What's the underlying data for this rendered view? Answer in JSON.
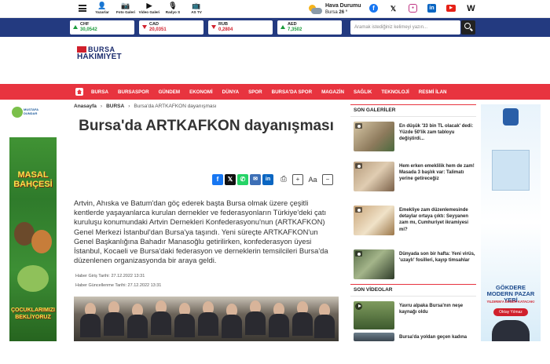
{
  "header": {
    "top_links": [
      {
        "label": "Yazarlar",
        "icon": "writers-icon"
      },
      {
        "label": "Foto Galeri",
        "icon": "photo-gallery-icon"
      },
      {
        "label": "Video Galeri",
        "icon": "video-gallery-icon"
      },
      {
        "label": "Radyo S",
        "icon": "radio-icon"
      },
      {
        "label": "AS TV",
        "icon": "tv-icon"
      }
    ],
    "weather": {
      "title": "Hava Durumu",
      "city": "Bursa",
      "temp": "26 °"
    },
    "socials": [
      "facebook",
      "x",
      "instagram",
      "linkedin",
      "youtube",
      "w"
    ]
  },
  "markets": [
    {
      "code": "CHF",
      "value": "30,0542",
      "trend": "up"
    },
    {
      "code": "CAD",
      "value": "20,0351",
      "trend": "down"
    },
    {
      "code": "RUB",
      "value": "0,2804",
      "trend": "down"
    },
    {
      "code": "AED",
      "value": "7,3502",
      "trend": "up"
    }
  ],
  "search": {
    "placeholder": "Aramak istediğiniz kelimeyi yazın..."
  },
  "logo": {
    "line1": "BURSA",
    "line2": "HAKIMIYET"
  },
  "nav": [
    "BURSA",
    "BURSASPOR",
    "GÜNDEM",
    "EKONOMİ",
    "DÜNYA",
    "SPOR",
    "BURSA'DA SPOR",
    "MAGAZİN",
    "SAĞLIK",
    "TEKNOLOJİ",
    "RESMİ İLAN"
  ],
  "left_ad": {
    "brand_line1": "MUSTAFA",
    "brand_line2": "DUNDAR",
    "title": "MASAL BAHÇESİ",
    "bottom": "ÇOCUKLARIMIZI BEKLİYORUZ"
  },
  "right_ad": {
    "title": "GÖKDERE MODERN PAZAR YERİ",
    "subtitle": "YILDIRIM'A DEĞER KATACAK!",
    "signature": "Oktay Yılmaz",
    "name": "OKTAY YILMAZ"
  },
  "article": {
    "breadcrumb": [
      "Anasayfa",
      "BURSA",
      "Bursa'da ARTKAFKON dayanışması"
    ],
    "title": "Bursa'da ARTKAFKON dayanışması",
    "summary": "Artvin, Ahıska ve Batum'dan göç ederek başta Bursa olmak üzere çeşitli kentlerde yaşayanlarca kurulan dernekler ve federasyonların Türkiye'deki çatı kuruluşu konumundaki Artvin Dernekleri Konfederasyonu'nun (ARTKAFKON) Genel Merkezi İstanbul'dan Bursa'ya taşındı. Yeni süreçte ARTKAFKON'un Genel Başkanlığına Bahadır Manasoğlu getirilirken, konfederasyon üyesi İstanbul, Kocaeli ve Bursa'daki federasyon ve derneklerin temsilcileri Bursa'da düzenlenen organizasyonda bir araya geldi.",
    "created": "Haber Giriş Tarihi: 27.12.2022 13:31",
    "updated": "Haber Güncellenme Tarihi: 27.12.2022 13:31",
    "font_label": "Aa"
  },
  "sidebar": {
    "galleries_title": "SON GALERİLER",
    "galleries": [
      {
        "caption": "En düşük '33 bin TL olacak' dedi: Yüzde 50'lik zam tabloyu değiştirdi..."
      },
      {
        "caption": "Hem erken emeklilik hem de zam! Masada 3 başlık var: Talimatı yerine getireceğiz"
      },
      {
        "caption": "Emekliye zam düzenlemesinde detaylar ortaya çıktı: Seyyanen zam mı, Cumhuriyet ikramiyesi mi?"
      },
      {
        "caption": "Dünyada son bir hafta: Yeni virüs, 'uzaylı' fosilleri, kayıp timsahlar"
      }
    ],
    "videos_title": "SON VİDEOLAR",
    "videos": [
      {
        "caption": "Yavru alpaka Bursa'nın neşe kaynağı oldu"
      },
      {
        "caption": "Bursa'da yoldan geçen kadına"
      }
    ]
  }
}
